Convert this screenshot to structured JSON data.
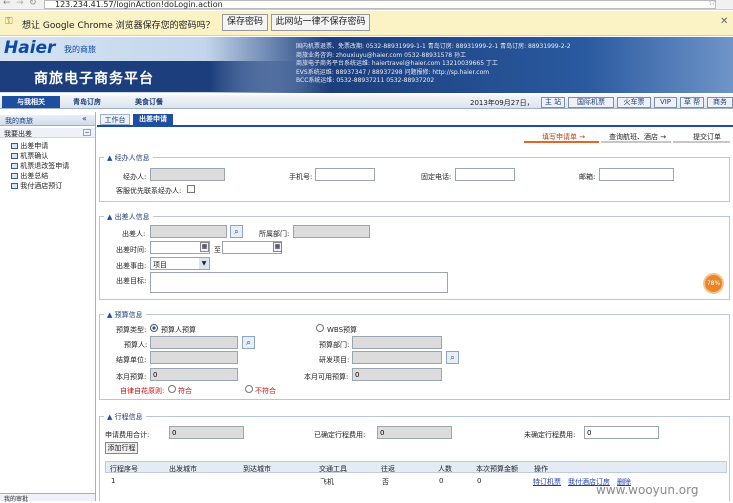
{
  "browser": {
    "url": "123.234.41.57/loginAction!doLogin.action",
    "save_prompt": "想让 Google Chrome 浏览器保存您的密码吗？",
    "save_btn": "保存密码",
    "never_btn": "此网站一律不保存密码"
  },
  "banner": {
    "logo": "Haier",
    "logo_cn": "我的商旅",
    "title": "商旅电子商务平台",
    "info_lines": [
      "国内机票退票、免票改期: 0532-88931999-1-1  青岛订房: 88931999-2-1  青岛订房: 88931999-2-2",
      "商旅业务咨询: zhouxiuyu@haier.com  0532-88931578  孙工",
      "商旅电子商务平台系统运维: haiertravel@haier.com  13210039665  丁工",
      "EVS系统运维: 88937347 / 88937298  问题报修: http://sp.haier.com",
      "BCC系统运维: 0532-88937211  0532-88937202"
    ]
  },
  "nav": {
    "tabs": [
      "与我相关",
      "青岛订房",
      "美食订餐"
    ],
    "date": "2013年09月27日，",
    "links": [
      "主 站",
      "国际机票",
      "火车票",
      "VIP",
      "草 帮",
      "商务"
    ]
  },
  "sidebar": {
    "header": "我的商旅",
    "group": "我要出差",
    "items": [
      "出差申请",
      "机票确认",
      "机票退改签申请",
      "出差总结",
      "我付酒店预订"
    ],
    "bottom": "我的审批"
  },
  "content_tabs": [
    "工作台",
    "出差申请"
  ],
  "steps": [
    "填写申请单",
    "查询航班、酒店",
    "提交订单"
  ],
  "handler": {
    "title": "经办人信息",
    "name_label": "经办人:",
    "phone_label": "手机号:",
    "tel_label": "固定电话:",
    "email_label": "邮箱:",
    "priority_label": "客服优先联系经办人:"
  },
  "traveler": {
    "title": "出差人信息",
    "person_label": "出差人:",
    "dept_label": "所属部门:",
    "time_label": "出差时间:",
    "to_label": "至",
    "reason_label": "出差事由:",
    "reason_value": "项目",
    "goal_label": "出差目标:"
  },
  "budget": {
    "title": "预算信息",
    "type_label": "预算类型:",
    "type_opt1": "预算人预算",
    "type_opt2": "WBS预算",
    "budget_person_label": "预算人:",
    "budget_dept_label": "预算部门:",
    "settle_label": "结算单位:",
    "rd_label": "研发项目:",
    "month_label": "本月预算:",
    "month_value": "0",
    "month_avail_label": "本月可用预算:",
    "month_avail_value": "0",
    "rule_label": "自律自花原则:",
    "rule_yes": "符合",
    "rule_no": "不符合"
  },
  "trip": {
    "title": "行程信息",
    "total_label": "申请费用合计:",
    "total_value": "0",
    "confirmed_label": "已确定行程费用:",
    "confirmed_value": "0",
    "unconfirmed_label": "未确定行程费用:",
    "unconfirmed_value": "0",
    "add_btn": "添加行程",
    "columns": [
      "行程序号",
      "出发城市",
      "到达城市",
      "交通工具",
      "往返",
      "人数",
      "本次预算金额",
      "操作"
    ],
    "rows": [
      {
        "no": "1",
        "from": "",
        "to": "",
        "vehicle": "飞机",
        "roundtrip": "否",
        "people": "0",
        "budget": "0",
        "ops": [
          "特订机票",
          "我付酒店订房",
          "删除"
        ]
      }
    ]
  },
  "badge": "78%",
  "watermark": "www.wooyun.org",
  "colors": {
    "nav_blue": "#1d4f9e",
    "accent_orange": "#e0662b",
    "banner_dark": "#1c3e7c"
  }
}
